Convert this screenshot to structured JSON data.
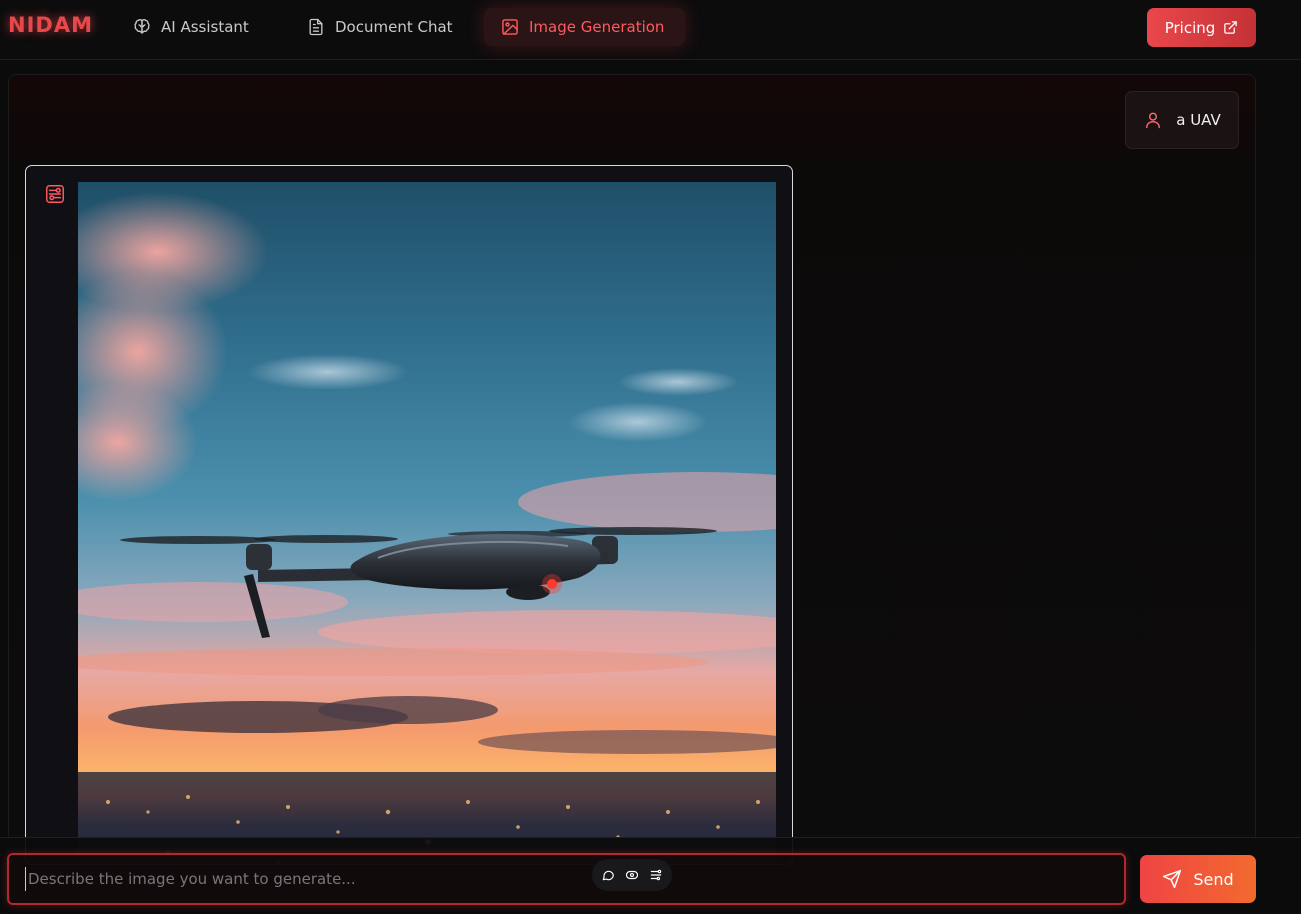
{
  "brand": {
    "logo_text": "NIDAM",
    "accent": "#e8484c"
  },
  "nav": {
    "items": [
      {
        "label": "AI Assistant",
        "icon": "brain-icon"
      },
      {
        "label": "Document Chat",
        "icon": "document-icon"
      },
      {
        "label": "Image Generation",
        "icon": "image-icon",
        "active": true
      }
    ],
    "pricing_label": "Pricing",
    "pricing_icon": "external-link-icon"
  },
  "chat": {
    "user_message": "a UAV",
    "user_icon": "user-icon",
    "assistant_icon": "image-generation-icon",
    "generated_image": "generated image of a quadcopter drone flying over a city at sunset"
  },
  "input": {
    "placeholder": "Describe the image you want to generate...",
    "value": "",
    "mode_icons": [
      "chat-bubble-icon",
      "eye-icon",
      "sliders-icon"
    ],
    "send_label": "Send",
    "send_icon": "send-icon"
  },
  "colors": {
    "background": "#0b0b0c",
    "active_tab_bg": "#2a1416",
    "active_tab_text": "#ff5a5f",
    "send_gradient_start": "#ef4444",
    "send_gradient_end": "#f26a2e"
  }
}
